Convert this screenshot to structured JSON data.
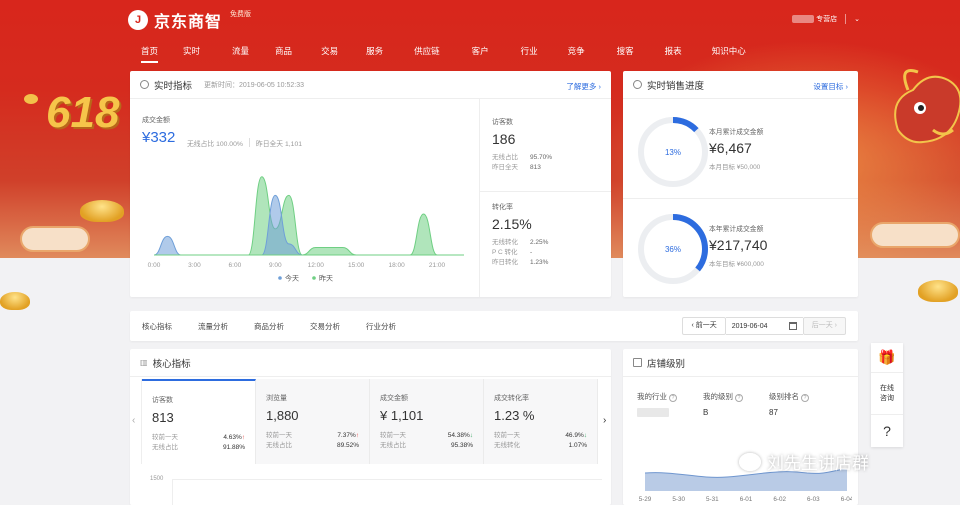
{
  "brand": {
    "name": "京东商智",
    "edition": "免费版",
    "mark": "J"
  },
  "account": {
    "name": "专营店"
  },
  "nav": [
    "首页",
    "实时",
    "流量",
    "商品",
    "交易",
    "服务",
    "供应链",
    "客户",
    "行业",
    "竞争",
    "搜客",
    "报表",
    "知识中心"
  ],
  "decoration": {
    "text": "618"
  },
  "realtime": {
    "title": "实时指标",
    "updated": "更新时间：2019-06-05 10:52:33",
    "more": "了解更多 ›",
    "gmv_label": "成交金额",
    "gmv_value": "¥332",
    "gmv_wireless": "无线占比 100.00%",
    "gmv_yesterday": "昨日全天 1,101",
    "visitors_label": "访客数",
    "visitors_value": "186",
    "visitors_wireless_k": "无线占比",
    "visitors_wireless_v": "95.70%",
    "visitors_yesterday_k": "昨日全天",
    "visitors_yesterday_v": "813",
    "conv_label": "转化率",
    "conv_value": "2.15%",
    "conv_rows": [
      {
        "k": "无线转化",
        "v": "2.25%"
      },
      {
        "k": "P C 转化",
        "v": "-"
      },
      {
        "k": "昨日转化",
        "v": "1.23%"
      }
    ]
  },
  "chart_data": {
    "type": "area",
    "categories": [
      "0:00",
      "3:00",
      "6:00",
      "9:00",
      "12:00",
      "15:00",
      "18:00",
      "21:00"
    ],
    "hours": [
      0,
      1,
      2,
      3,
      4,
      5,
      6,
      7,
      8,
      9,
      10,
      11,
      12,
      13,
      14,
      15,
      16,
      17,
      18,
      19,
      20,
      21,
      22,
      23
    ],
    "series": [
      {
        "name": "今天",
        "color": "#6f9fd8",
        "values": [
          0,
          0.5,
          0,
          0,
          0,
          0,
          0,
          0,
          0,
          1.6,
          0.3,
          0,
          0,
          0,
          0,
          0,
          0,
          0,
          0,
          0,
          0,
          0,
          0,
          0
        ]
      },
      {
        "name": "昨天",
        "color": "#6fcf83",
        "values": [
          0,
          0,
          0,
          0,
          0,
          0,
          0,
          0,
          2.1,
          0.7,
          1.6,
          0,
          0.2,
          0.2,
          0.2,
          0,
          0,
          0,
          0,
          0,
          1.1,
          0,
          0,
          0
        ]
      }
    ],
    "grid": false,
    "legend": "bottom-center"
  },
  "progress": {
    "title": "实时销售进度",
    "link": "设置目标 ›",
    "month": {
      "pct": "13%",
      "fraction": 0.13,
      "label": "本月累计成交金额",
      "value": "¥6,467",
      "target": "本月目标  ¥50,000"
    },
    "year": {
      "pct": "36%",
      "fraction": 0.36,
      "label": "本年累计成交金额",
      "value": "¥217,740",
      "target": "本年目标  ¥600,000"
    }
  },
  "tabs": [
    "核心指标",
    "流量分析",
    "商品分析",
    "交易分析",
    "行业分析"
  ],
  "datebar": {
    "prev": "‹ 前一天",
    "date": "2019-06-04",
    "next": "后一天 ›"
  },
  "core": {
    "title": "核心指标",
    "metrics": [
      {
        "label": "访客数",
        "value": "813",
        "r1k": "较前一天",
        "r1v": "4.63%",
        "dir": "up",
        "r2k": "无线占比",
        "r2v": "91.88%"
      },
      {
        "label": "浏览量",
        "value": "1,880",
        "r1k": "较前一天",
        "r1v": "7.37%",
        "dir": "up",
        "r2k": "无线占比",
        "r2v": "89.52%"
      },
      {
        "label": "成交金额",
        "value": "¥ 1,101",
        "r1k": "较前一天",
        "r1v": "54.38%",
        "dir": "down",
        "r2k": "无线占比",
        "r2v": "95.38%"
      },
      {
        "label": "成交转化率",
        "value": "1.23 %",
        "r1k": "较前一天",
        "r1v": "46.9%",
        "dir": "down",
        "r2k": "无线转化",
        "r2v": "1.07%"
      }
    ],
    "y_tick": "1500"
  },
  "shoplevel": {
    "title": "店铺级别",
    "industry_label": "我的行业",
    "level_label": "我的级别",
    "level_value": "B",
    "rank_label": "级别排名",
    "rank_value": "87",
    "help": "?",
    "chart": {
      "categories": [
        "5-29",
        "5-30",
        "5-31",
        "6-01",
        "6-02",
        "6-03",
        "6-04"
      ]
    }
  },
  "rail": {
    "consult": [
      "在线",
      "咨询"
    ],
    "help": "?"
  },
  "watermark": "刘先生讲店群"
}
